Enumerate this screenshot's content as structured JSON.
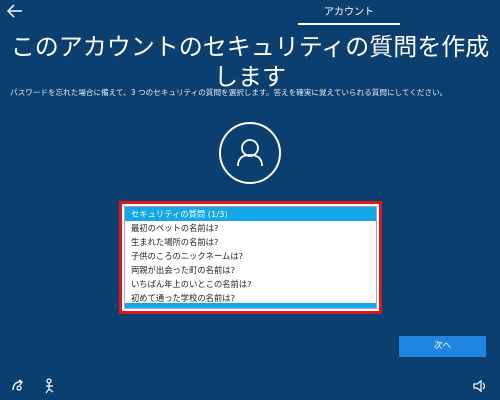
{
  "topbar": {
    "back_icon": "back-arrow-icon",
    "tab_label": "アカウント"
  },
  "header": {
    "title": "このアカウントのセキュリティの質問を作成します",
    "subtitle": "パスワードを忘れた場合に備えて、3 つのセキュリティの質問を選択します。答えを確実に覚えていられる質問にしてください。"
  },
  "avatar": {
    "icon": "user-icon"
  },
  "question_list": {
    "options": [
      "セキュリティの質問 (1/3)",
      "最初のペットの名前は?",
      "生まれた場所の名前は?",
      "子供のころのニックネームは?",
      "両親が出会った町の名前は?",
      "いちばん年上のいとこの名前は?",
      "初めて通った学校の名前は?"
    ],
    "selected_index": 0
  },
  "footer": {
    "next_label": "次へ"
  },
  "bottombar": {
    "left_icons": [
      "ease-of-access-icon",
      "accessibility-person-icon"
    ],
    "right_icon": "speaker-icon"
  },
  "colors": {
    "background": "#0b3f70",
    "selection": "#13a6e8",
    "highlight_border": "#e0161e",
    "button": "#1f86e0"
  }
}
